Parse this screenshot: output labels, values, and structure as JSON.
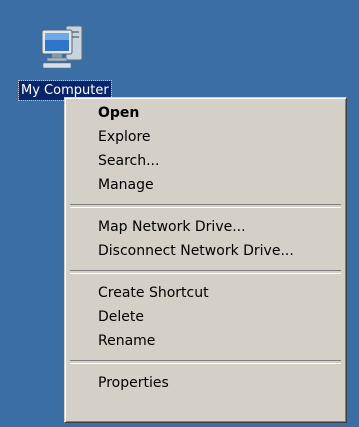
{
  "desktop": {
    "background_color": "#3a6ea5",
    "icon": {
      "name": "computer-icon",
      "label": "My Computer"
    }
  },
  "context_menu": {
    "groups": [
      [
        "Open",
        "Explore",
        "Search...",
        "Manage"
      ],
      [
        "Map Network Drive...",
        "Disconnect Network Drive..."
      ],
      [
        "Create Shortcut",
        "Delete",
        "Rename"
      ],
      [
        "Properties"
      ]
    ],
    "default_item": "Open",
    "background_color": "#d4d0c8",
    "selection_color": "#0a246a"
  }
}
